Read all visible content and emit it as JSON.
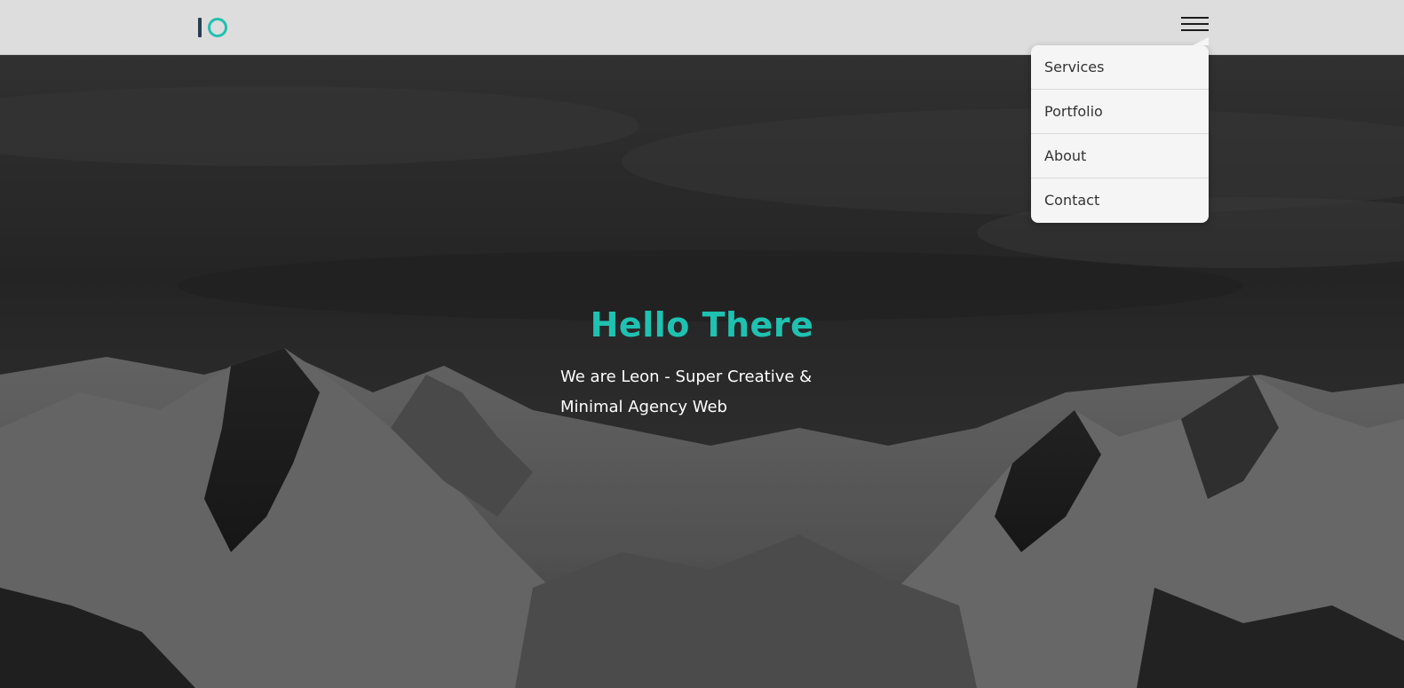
{
  "header": {
    "logo_icon": "io-logo",
    "menu_icon": "hamburger-menu-icon",
    "background_color": "#dddddd"
  },
  "nav": {
    "items": [
      {
        "label": "Services"
      },
      {
        "label": "Portfolio"
      },
      {
        "label": "About"
      },
      {
        "label": "Contact"
      }
    ]
  },
  "hero": {
    "title": "Hello There",
    "subtitle": "We are Leon - Super Creative & Minimal Agency Web",
    "background": "snowy-mountain-range-grayscale"
  },
  "colors": {
    "accent": "#1fc1b1",
    "logo_dark": "#2c3e50",
    "text_light": "#ffffff",
    "menu_bg": "#f5f5f5"
  }
}
